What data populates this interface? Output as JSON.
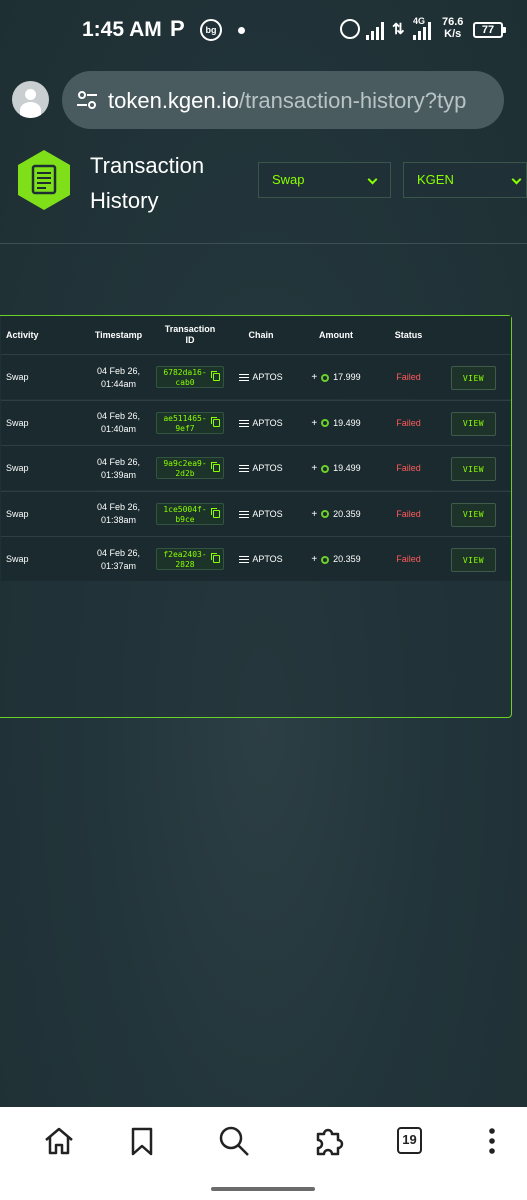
{
  "status_bar": {
    "time": "1:45 AM",
    "app_letter": "P",
    "app_badge": "bg",
    "network_type": "4G",
    "net_speed_value": "76.6",
    "net_speed_unit": "K/s",
    "battery": "77"
  },
  "browser": {
    "url_domain": "token.kgen.io",
    "url_path": "/transaction-history?typ",
    "tabs_count": "19"
  },
  "header": {
    "title_line1": "Transaction",
    "title_line2": "History",
    "activity_filter": "Swap",
    "token_filter": "KGEN",
    "accent_color": "#8aff00"
  },
  "table": {
    "columns": [
      "Activity",
      "Timestamp",
      "Transaction ID",
      "Chain",
      "Amount",
      "Status"
    ],
    "rows": [
      {
        "activity": "Swap",
        "date": "04 Feb 26,",
        "time": "01:44am",
        "txid_1": "6782da16-",
        "txid_2": "cab0",
        "chain": "APTOS",
        "amount": "17.999",
        "status": "Failed",
        "action": "VIEW"
      },
      {
        "activity": "Swap",
        "date": "04 Feb 26,",
        "time": "01:40am",
        "txid_1": "ae511465-",
        "txid_2": "9ef7",
        "chain": "APTOS",
        "amount": "19.499",
        "status": "Failed",
        "action": "VIEW"
      },
      {
        "activity": "Swap",
        "date": "04 Feb 26,",
        "time": "01:39am",
        "txid_1": "9a9c2ea9-",
        "txid_2": "2d2b",
        "chain": "APTOS",
        "amount": "19.499",
        "status": "Failed",
        "action": "VIEW"
      },
      {
        "activity": "Swap",
        "date": "04 Feb 26,",
        "time": "01:38am",
        "txid_1": "1ce5004f-",
        "txid_2": "b9ce",
        "chain": "APTOS",
        "amount": "20.359",
        "status": "Failed",
        "action": "VIEW"
      },
      {
        "activity": "Swap",
        "date": "04 Feb 26,",
        "time": "01:37am",
        "txid_1": "f2ea2403-",
        "txid_2": "2828",
        "chain": "APTOS",
        "amount": "20.359",
        "status": "Failed",
        "action": "VIEW"
      }
    ]
  }
}
